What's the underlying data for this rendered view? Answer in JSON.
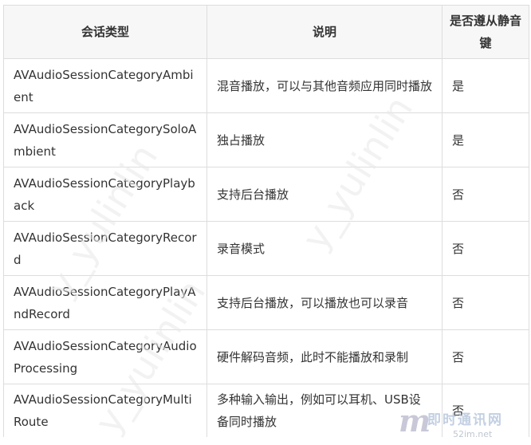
{
  "table": {
    "headers": [
      "会话类型",
      "说明",
      "是否遵从静音键"
    ],
    "rows": [
      {
        "category": "AVAudioSessionCategoryAmbient",
        "description": "混音播放，可以与其他音频应用同时播放",
        "obeys_mute": "是"
      },
      {
        "category": "AVAudioSessionCategorySoloAmbient",
        "description": "独占播放",
        "obeys_mute": "是"
      },
      {
        "category": "AVAudioSessionCategoryPlayback",
        "description": "支持后台播放",
        "obeys_mute": "否"
      },
      {
        "category": "AVAudioSessionCategoryRecord",
        "description": "录音模式",
        "obeys_mute": "否"
      },
      {
        "category": "AVAudioSessionCategoryPlayAndRecord",
        "description": "支持后台播放，可以播放也可以录音",
        "obeys_mute": "否"
      },
      {
        "category": "AVAudioSessionCategoryAudioProcessing",
        "description": "硬件解码音频，此时不能播放和录制",
        "obeys_mute": "否"
      },
      {
        "category": "AVAudioSessionCategoryMultiRoute",
        "description": "多种输入输出，例如可以耳机、USB设备同时播放",
        "obeys_mute": "否"
      }
    ]
  },
  "watermarks": [
    "y_yulinlin",
    "y_yulinlin",
    "y_yulinlin"
  ],
  "logo": {
    "mark": "m",
    "name": "即时通讯网",
    "url": "52im.net"
  }
}
